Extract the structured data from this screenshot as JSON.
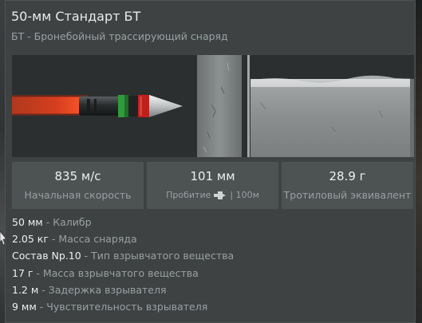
{
  "shell": {
    "title": "50-мм Стандарт БТ",
    "subtitle": "БТ - Бронебойный трассирующий снаряд"
  },
  "stats": [
    {
      "value": "835 м/с",
      "label": "Начальная скорость"
    },
    {
      "value": "101 мм",
      "label": "Пробитие",
      "suffix": "| 100м"
    },
    {
      "value": "28.9 г",
      "label": "Тротиловый эквивалент"
    }
  ],
  "properties": [
    {
      "value": "50 мм",
      "sep": " - ",
      "name": "Калибр"
    },
    {
      "value": "2.05 кг",
      "sep": " - ",
      "name": "Масса снаряда"
    },
    {
      "value": "Состав Np.10",
      "sep": " - ",
      "name": "Тип взрывчатого вещества"
    },
    {
      "value": "17 г",
      "sep": " - ",
      "name": "Масса взрывчатого вещества"
    },
    {
      "value": "1.2 м",
      "sep": " - ",
      "name": "Задержка взрывателя"
    },
    {
      "value": "9 мм",
      "sep": " - ",
      "name": "Чувствительность взрывателя"
    }
  ],
  "icons": {
    "penetration": "penetration-icon",
    "cursor": "cursor-arrow-icon"
  },
  "colors": {
    "panel_bg": "#3e4243",
    "stat_bg": "#4d5253",
    "value_text": "#eef0f0",
    "muted_text": "#99a1a3",
    "tracer_red": "#c0201c",
    "band_green": "#2f9b3a"
  }
}
